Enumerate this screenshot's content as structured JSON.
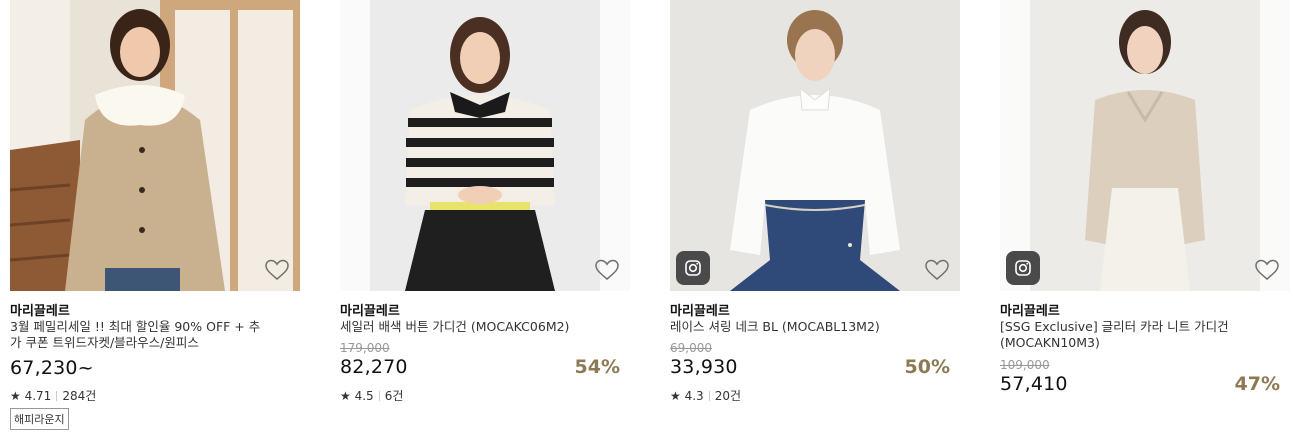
{
  "products": [
    {
      "brand": "마리끌레르",
      "title": "3월 페밀리세일 !! 최대 할인율 90% OFF + 추가 쿠폰 트위드자켓/블라우스/원피스",
      "price": "67,230~",
      "rating": "4.71",
      "reviews": "284건",
      "badge": "해피라운지",
      "instagram": false
    },
    {
      "brand": "마리끌레르",
      "title": "세일러 배색 버튼 가디건 (MOCAKC06M2)",
      "original_price": "179,000",
      "price": "82,270",
      "discount": "54%",
      "rating": "4.5",
      "reviews": "6건",
      "instagram": false
    },
    {
      "brand": "마리끌레르",
      "title": "레이스 셔링 네크 BL (MOCABL13M2)",
      "original_price": "69,000",
      "price": "33,930",
      "discount": "50%",
      "rating": "4.3",
      "reviews": "20건",
      "instagram": true
    },
    {
      "brand": "마리끌레르",
      "title": "[SSG Exclusive] 글리터 카라 니트 가디건 (MOCAKN10M3)",
      "original_price": "109,000",
      "price": "57,410",
      "discount": "47%",
      "instagram": true
    }
  ],
  "icons": {
    "wishlist": "heart-outline-icon",
    "instagram": "instagram-icon",
    "rating": "star-icon"
  },
  "colors": {
    "discount": "#8c7a52",
    "strike": "#999999"
  }
}
